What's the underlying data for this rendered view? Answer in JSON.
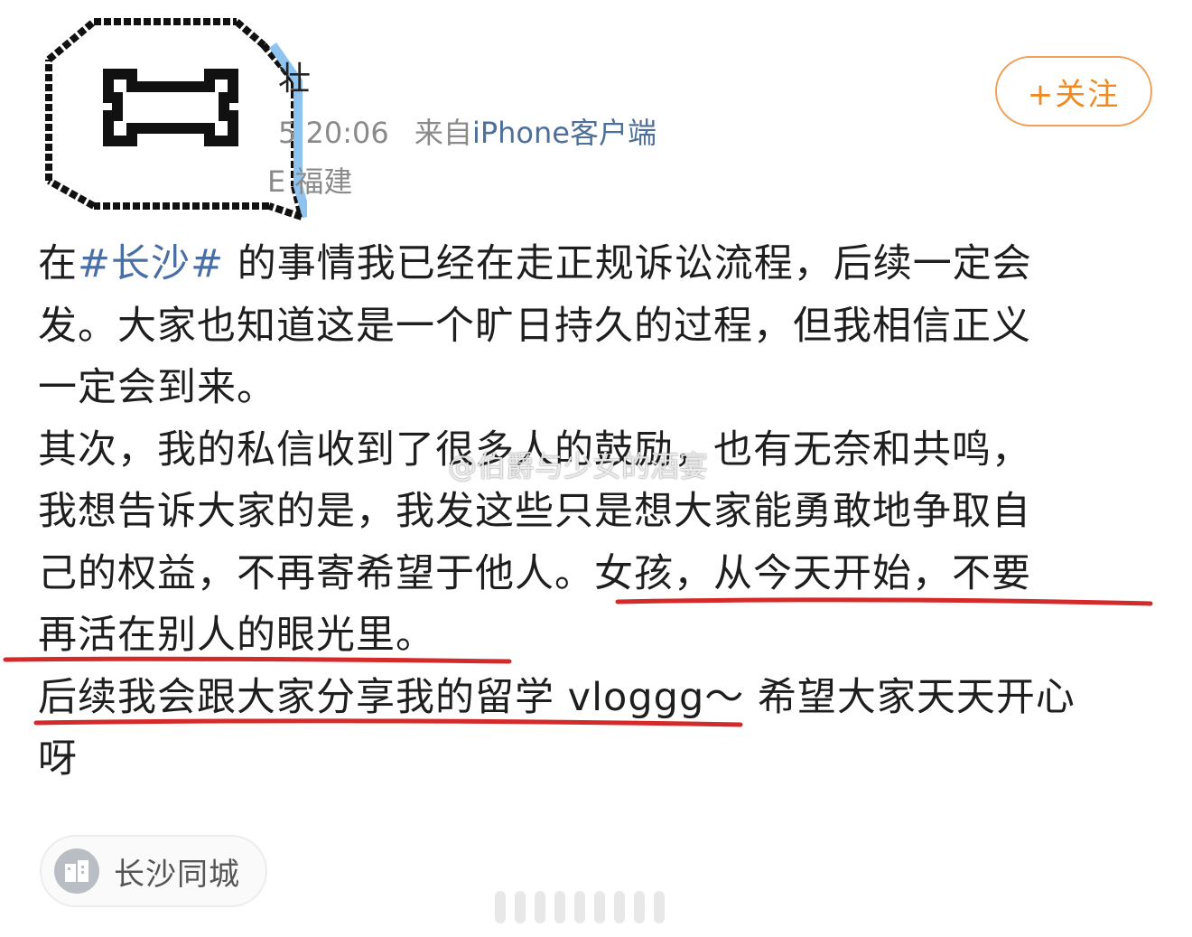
{
  "header": {
    "username_partial": "壮",
    "time_partial": "5 20:06",
    "from_label": "来自",
    "client": "iPhone客户端",
    "location_partial": "E 福建",
    "follow_label": "+关注"
  },
  "post": {
    "prefix": "在",
    "tag": "#长沙#",
    "line1_rest": " 的事情我已经在走正规诉讼流程，后续一定会",
    "line2": "发。大家也知道这是一个旷日持久的过程，但我相信正义",
    "line3": "一定会到来。",
    "line4": "其次，我的私信收到了很多人的鼓励，也有无奈和共鸣，",
    "line5": "我想告诉大家的是，我发这些只是想大家能勇敢地争取自",
    "line6": "己的权益，不再寄希望于他人。女孩，从今天开始，不要",
    "line7": "再活在别人的眼光里。",
    "line8": "后续我会跟大家分享我的留学 vloggg～ 希望大家天天开心",
    "line9": "呀"
  },
  "watermark": "@伯爵与少女的酒宴",
  "location_chip": {
    "label": "长沙同城",
    "icon": "building-icon"
  },
  "colors": {
    "tag": "#4a6fa5",
    "follow": "#f08a24",
    "underline": "#d42a2a"
  }
}
